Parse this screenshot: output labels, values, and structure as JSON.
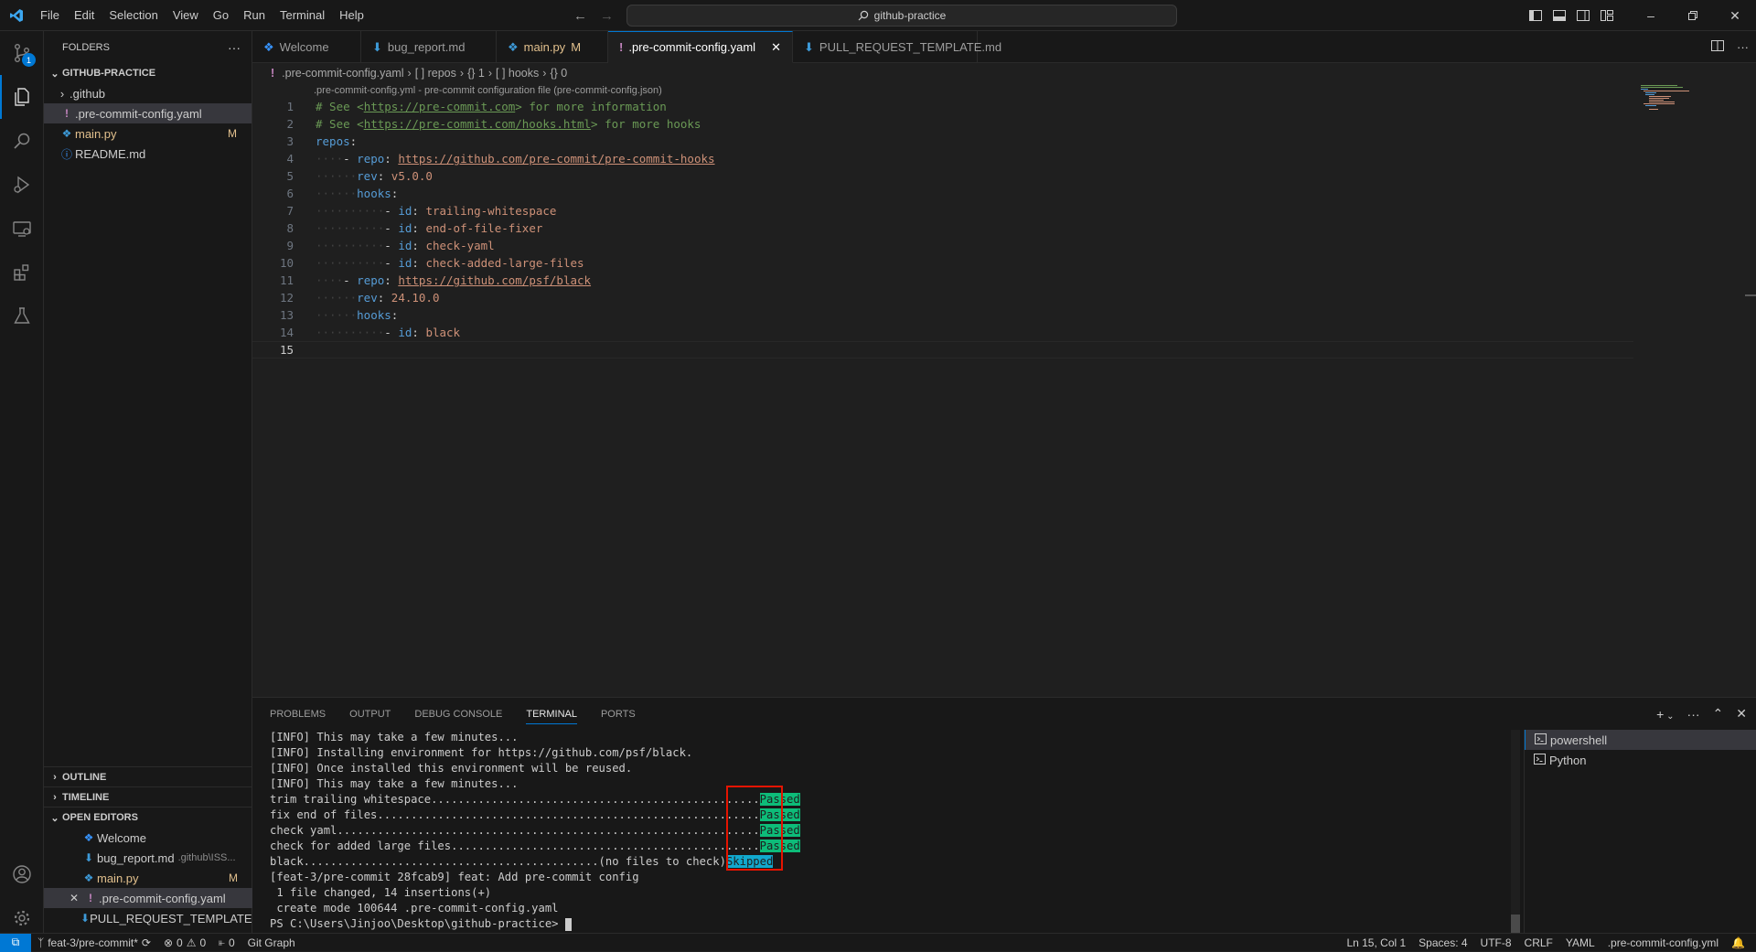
{
  "menu": [
    "File",
    "Edit",
    "Selection",
    "View",
    "Go",
    "Run",
    "Terminal",
    "Help"
  ],
  "command_center": "github-practice",
  "activity": {
    "scm_badge": "1"
  },
  "explorer": {
    "header": "FOLDERS",
    "root": "GITHUB-PRACTICE",
    "items": [
      {
        "label": ".github",
        "type": "folder"
      },
      {
        "label": ".pre-commit-config.yaml",
        "type": "yaml"
      },
      {
        "label": "main.py",
        "type": "py",
        "deco": "M"
      },
      {
        "label": "README.md",
        "type": "info"
      }
    ],
    "outline": "OUTLINE",
    "timeline": "TIMELINE",
    "open_editors": {
      "title": "OPEN EDITORS",
      "items": [
        {
          "label": "Welcome",
          "desc": ""
        },
        {
          "label": "bug_report.md",
          "desc": ".github\\ISS..."
        },
        {
          "label": "main.py",
          "desc": "",
          "deco": "M"
        },
        {
          "label": ".pre-commit-config.yaml",
          "desc": ""
        },
        {
          "label": "PULL_REQUEST_TEMPLATE...",
          "desc": ""
        }
      ]
    }
  },
  "tabs": [
    {
      "label": "Welcome",
      "mod": ""
    },
    {
      "label": "bug_report.md",
      "mod": ""
    },
    {
      "label": "main.py",
      "mod": "M"
    },
    {
      "label": ".pre-commit-config.yaml",
      "mod": ""
    },
    {
      "label": "PULL_REQUEST_TEMPLATE.md",
      "mod": ""
    }
  ],
  "breadcrumb": [
    ".pre-commit-config.yaml",
    "[ ] repos",
    "{} 1",
    "[ ] hooks",
    "{} 0"
  ],
  "schema_hint": ".pre-commit-config.yml - pre-commit configuration file (pre-commit-config.json)",
  "code": {
    "l1": {
      "hash": "# See <",
      "link": "https://pre-commit.com",
      "rest": "> for more information"
    },
    "l2": {
      "hash": "# See <",
      "link": "https://pre-commit.com/hooks.html",
      "rest": "> for more hooks"
    },
    "repos": "repos",
    "repo": "repo",
    "rev": "rev",
    "hooks": "hooks",
    "id": "id",
    "repo1_url": "https://github.com/pre-commit/pre-commit-hooks",
    "repo1_rev": "v5.0.0",
    "hooks1": [
      "trailing-whitespace",
      "end-of-file-fixer",
      "check-yaml",
      "check-added-large-files"
    ],
    "repo2_url": "https://github.com/psf/black",
    "repo2_rev": "24.10.0",
    "hooks2": [
      "black"
    ]
  },
  "panel": {
    "tabs": [
      "PROBLEMS",
      "OUTPUT",
      "DEBUG CONSOLE",
      "TERMINAL",
      "PORTS"
    ],
    "terminal_lines": [
      "[INFO] This may take a few minutes...",
      "[INFO] Installing environment for https://github.com/psf/black.",
      "[INFO] Once installed this environment will be reused.",
      "[INFO] This may take a few minutes..."
    ],
    "checks": [
      {
        "text": "trim trailing whitespace.................................................",
        "result": "Passed"
      },
      {
        "text": "fix end of files.........................................................",
        "result": "Passed"
      },
      {
        "text": "check yaml...............................................................",
        "result": "Passed"
      },
      {
        "text": "check for added large files..............................................",
        "result": "Passed"
      },
      {
        "text": "black............................................(no files to check)",
        "result": "Skipped"
      }
    ],
    "after_lines": [
      "[feat-3/pre-commit 28fcab9] feat: Add pre-commit config",
      " 1 file changed, 14 insertions(+)",
      " create mode 100644 .pre-commit-config.yaml"
    ],
    "prompt": "PS C:\\Users\\Jinjoo\\Desktop\\github-practice> ",
    "terminals": [
      "powershell",
      "Python"
    ]
  },
  "status": {
    "branch": "feat-3/pre-commit*",
    "errors": "0",
    "warnings": "0",
    "ports": "0",
    "git_graph": "Git Graph",
    "position": "Ln 15, Col 1",
    "spaces": "Spaces: 4",
    "encoding": "UTF-8",
    "eol": "CRLF",
    "language": "YAML",
    "schema": ".pre-commit-config.yml"
  },
  "colors": {
    "accent": "#0078d4",
    "passed": "#0dbc79",
    "skipped": "#11a8cd",
    "highlight_box": "#e51400"
  }
}
